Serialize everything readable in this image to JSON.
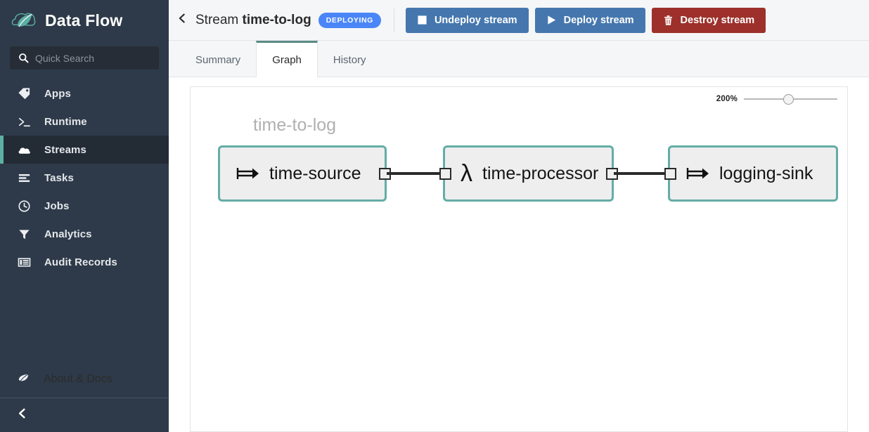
{
  "sidebar": {
    "brand": {
      "title": "Data Flow",
      "logo_icon": "spring-leaf-cloud-logo"
    },
    "search": {
      "placeholder": "Quick Search",
      "value": "",
      "icon": "search-icon"
    },
    "items": [
      {
        "label": "Apps",
        "icon": "tag-icon",
        "active": false
      },
      {
        "label": "Runtime",
        "icon": "terminal-icon",
        "active": false
      },
      {
        "label": "Streams",
        "icon": "cloud-icon",
        "active": true
      },
      {
        "label": "Tasks",
        "icon": "tasks-icon",
        "active": false
      },
      {
        "label": "Jobs",
        "icon": "clock-icon",
        "active": false
      },
      {
        "label": "Analytics",
        "icon": "funnel-icon",
        "active": false
      },
      {
        "label": "Audit Records",
        "icon": "table-icon",
        "active": false
      }
    ],
    "footer": {
      "label": "About & Docs",
      "icon": "leaf-icon"
    },
    "collapse": {
      "icon": "chevron-left-icon"
    },
    "colors": {
      "background": "#2e3a49",
      "active_background": "#232b35",
      "active_accent": "#5bb0a4"
    }
  },
  "topbar": {
    "back_icon": "chevron-left-icon",
    "title_prefix": "Stream",
    "title_name": "time-to-log",
    "status": "DEPLOYING",
    "status_color": "#4a86f7",
    "buttons": [
      {
        "label": "Undeploy stream",
        "icon": "stop-square-icon",
        "style": "blue",
        "color": "#4577ae"
      },
      {
        "label": "Deploy stream",
        "icon": "play-triangle-icon",
        "style": "blue",
        "color": "#4577ae"
      },
      {
        "label": "Destroy stream",
        "icon": "trash-icon",
        "style": "red",
        "color": "#9d302b"
      }
    ]
  },
  "tabs": [
    {
      "label": "Summary",
      "active": false
    },
    {
      "label": "Graph",
      "active": true
    },
    {
      "label": "History",
      "active": false
    }
  ],
  "canvas": {
    "zoom": {
      "label": "200%",
      "value": 200,
      "min": 0,
      "max": 400,
      "thumb_percent": 46
    },
    "stream_label": "time-to-log",
    "nodes": [
      {
        "name": "time-source",
        "icon": "source-arrow-icon",
        "icon_glyph": "⇥",
        "type": "source"
      },
      {
        "name": "time-processor",
        "icon": "lambda-icon",
        "icon_glyph": "λ",
        "type": "processor"
      },
      {
        "name": "logging-sink",
        "icon": "sink-arrow-icon",
        "icon_glyph": "⇥",
        "type": "sink"
      }
    ],
    "node_border_color": "#64ada6",
    "node_fill_color": "#eeeeee"
  }
}
